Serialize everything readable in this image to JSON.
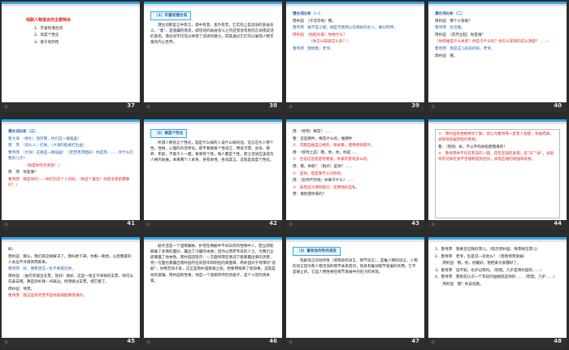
{
  "slides": [
    {
      "number": "37",
      "title": "戏剧人物语言的主要特点",
      "items": [
        "1、丰富的潜台词",
        "2、高度个性化",
        "3、富于动作性"
      ]
    },
    {
      "number": "38",
      "tag": "（1）丰富的潜台词",
      "para": "潜台词即是言中有言，意中有意，弦外有音，它实际上是话语的多层含义。“意”，是隐藏的意思。即话语的表层含义之内还有含有别的言语或说话的意思。潜台词不仅充分体现了话语的魅力，同其通过它们可以展现人物丰富的内心世界。"
    },
    {
      "number": "39",
      "heading": "潜台词分析（一）",
      "lines": [
        "周朴园　（汗涔涔地）哦。",
        "鲁侍萍　她不是小姐，她是无锡周公馆梅妈的女儿，她叫侍萍。",
        "周朴园　（抬起头来）你姓什么？",
        "（你怎么知道这么多？）",
        "鲁侍萍　我姓鲁，老爷。"
      ]
    },
    {
      "number": "40",
      "heading": "潜台词分析（二）",
      "lines": [
        "周朴园　那个小孩呢？",
        "鲁侍萍　也活着。",
        "周朴园　（忽然立起）你是谁？",
        "（你和她是什么关系？你是干什么的？你怎么知道的这么清楚？……）",
        "鲁侍萍　我是这儿四凤的妈，老爷。",
        "周朴园　哦。"
      ]
    },
    {
      "number": "41",
      "heading": "潜台词分析（三）",
      "lines": [
        "鲁大海　（挣扎）放开我，你们这一群强盗！",
        "周　萍　（向仆人）打他。（大海的脸被打出血）",
        "鲁侍萍　（大哭）这真是一群强盗！（走至周萍面前）你是萍，……凭什么打我的儿子？",
        "（他是你的亲弟弟！）",
        "周　萍　你是谁？",
        "鲁侍萍　我是你的——你打的这个人的妈。（你这个畜生！你连亲弟弟都要打！）"
      ]
    },
    {
      "number": "42",
      "tag": "（2）高度个性化",
      "para": "所谓人物语言个性化，就是什么样的人说什么样的话。话言应为人物个性，性格，心理的声音所化。即不要脱离个性语言，用语习惯、身份、教养、年龄，不能千人一面，要来有个性。每人都是个性，使之话语应该成为人格的发展。本来两个人本身，各有本性，各说其言。这就是高度个性化。"
    },
    {
      "number": "43",
      "lines": [
        "周：（惊愕）梅花？……",
        "鲁：还是那件，梅花什么的，她那件",
        "②　衣服是她自己绣的，很好看。使用感到意外。",
        "周：（惊愕之态）哦，你，你，你是……",
        "③　合适这话是感觉要紧，你紧的客观多么的。",
        "周：哦，你呢？（抱声）是你？……",
        "④　是你，但是我不认识你的。",
        "周：（忽然严厉地）你来干什么？……",
        "⑤　表现出冷漠和敌对，说明他的自私。",
        "周：谁指使你来的？"
      ]
    },
    {
      "number": "44",
      "lines": [
        "⑤　周朴园的性格特点了解，他认为鲁侍萍一定有人指使，有备而来，表现他多疑阴险的性格。",
        "鲁：（怒愤）命，不公平的命指使我来的！",
        "⑥　鲁侍萍并不仅仅有悲的一面，还有坚强的表现。说“天”“命”，加表现的对旧社会不合理制度的控诉，表现出她的刚强和反抗。"
      ]
    },
    {
      "number": "45",
      "lines": [
        "如：",
        "周朴园　那么，我们就这样解决了。我叫他下来，你看一看他，以后鲁家的人永远不许再到周家来。",
        "鲁侍萍　好，我希望这一生不要再见你。",
        "周朴园　（由内衣取出支票，签好）很好，这是一张五千块钱的支票，你可以先拿去用。算是弥补我一点罪过。侍萍接过支票，把它撕了。",
        "周朴园　侍萍。",
        "鲁侍萍　我这些年的苦不是你拿钱能算得清的。"
      ]
    },
    {
      "number": "46",
      "para": "剧才还是一个温情脉脉，护惜在梅嫂中不肯白问的性情中人，但立即就撕破了多情的面纱，露出了冷酷的本质；因为以周老爷日的人士，为我们立即暴露了他本性。周朴园还暗示：一方面侍萍在情况下能暴露出来的贪婪，另一方面也暴露出周朴园内在的狡诈和阴险的真面目。周朴园对于侍萍的“悲剧”，仿佛无动于衷，这正是周朴园狠毒之处，想要用钱来了结旧事，这就是他的逻辑。周朴园的性格，他是一个道貌岸然的伪君子，是个十足的资本家。"
    },
    {
      "number": "47",
      "tag": "（3）富有动作性的语言",
      "para": "戏剧语言的动作性（或称动作语言，情节语言），是推人物的语言，人物的语言因为和人物活动的情节关系密切，同具有推动情节发展的作用。它不是静止的，它是人物性格在情节发展中内在力的体现。"
    },
    {
      "number": "48",
      "lines": [
        "1、鲁侍萍　我要见见我的萍儿。（暗示周朴园，侍萍要见萍儿）",
        "2、鲁侍萍　老爷，您是见一见他么？（暗暗侍萍发展）",
        "　　周朴园　哦，他，他最好，暂把来大家都好了。",
        "3、鲁侍萍　说不知，也许记得吗。（暗暗。几乎是周朴园的……）",
        "4、鲁侍萍　我现在认识一个年轻的姑娘就是你的……（暗暗。几乎……）",
        "　　周朴园　哦？你说说看。"
      ]
    }
  ]
}
